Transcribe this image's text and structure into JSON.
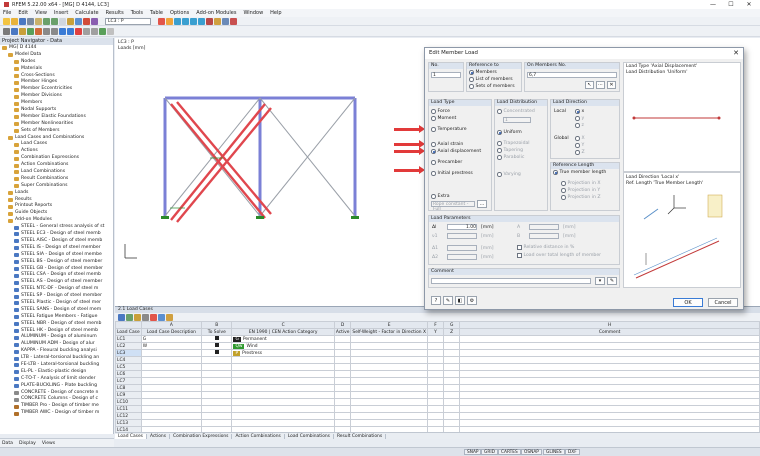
{
  "window": {
    "title": "RFEM 5.22.00 x64 - [MG] D 4144, LC3]",
    "min": "—",
    "max": "☐",
    "close": "✕"
  },
  "menu": [
    "File",
    "Edit",
    "View",
    "Insert",
    "Calculate",
    "Results",
    "Tools",
    "Table",
    "Options",
    "Add-on Modules",
    "Window",
    "Help"
  ],
  "toolbar": {
    "lc_select": "LC3 : P"
  },
  "navigator": {
    "title": "Project Navigator - Data",
    "items": [
      {
        "label": "MG] D 4144",
        "level": 0,
        "color": "#d8a33a"
      },
      {
        "label": "Model Data",
        "level": 1,
        "color": "#d8a33a"
      },
      {
        "label": "Nodes",
        "level": 2,
        "color": "#d8a33a"
      },
      {
        "label": "Materials",
        "level": 2,
        "color": "#d8a33a"
      },
      {
        "label": "Cross-Sections",
        "level": 2,
        "color": "#d8a33a"
      },
      {
        "label": "Member Hinges",
        "level": 2,
        "color": "#d8a33a"
      },
      {
        "label": "Member Eccentricities",
        "level": 2,
        "color": "#d8a33a"
      },
      {
        "label": "Member Divisions",
        "level": 2,
        "color": "#d8a33a"
      },
      {
        "label": "Members",
        "level": 2,
        "color": "#d8a33a"
      },
      {
        "label": "Nodal Supports",
        "level": 2,
        "color": "#d8a33a"
      },
      {
        "label": "Member Elastic Foundations",
        "level": 2,
        "color": "#d8a33a"
      },
      {
        "label": "Member Nonlinearities",
        "level": 2,
        "color": "#d8a33a"
      },
      {
        "label": "Sets of Members",
        "level": 2,
        "color": "#d8a33a"
      },
      {
        "label": "Load Cases and Combinations",
        "level": 1,
        "color": "#d8a33a"
      },
      {
        "label": "Load Cases",
        "level": 2,
        "color": "#d8a33a"
      },
      {
        "label": "Actions",
        "level": 2,
        "color": "#d8a33a"
      },
      {
        "label": "Combination Expressions",
        "level": 2,
        "color": "#d8a33a"
      },
      {
        "label": "Action Combinations",
        "level": 2,
        "color": "#d8a33a"
      },
      {
        "label": "Load Combinations",
        "level": 2,
        "color": "#d8a33a"
      },
      {
        "label": "Result Combinations",
        "level": 2,
        "color": "#d8a33a"
      },
      {
        "label": "Super Combinations",
        "level": 2,
        "color": "#d8a33a"
      },
      {
        "label": "Loads",
        "level": 1,
        "color": "#d8a33a"
      },
      {
        "label": "Results",
        "level": 1,
        "color": "#d8a33a"
      },
      {
        "label": "Printout Reports",
        "level": 1,
        "color": "#d8a33a"
      },
      {
        "label": "Guide Objects",
        "level": 1,
        "color": "#d8a33a"
      },
      {
        "label": "Add-on Modules",
        "level": 1,
        "color": "#d8a33a"
      },
      {
        "label": "STEEL - General stress analysis of st",
        "level": 2,
        "color": "#4a78c2"
      },
      {
        "label": "STEEL EC3 - Design of steel memb",
        "level": 2,
        "color": "#4a78c2"
      },
      {
        "label": "STEEL AISC - Design of steel memb",
        "level": 2,
        "color": "#4a78c2"
      },
      {
        "label": "STEEL IS - Design of steel member",
        "level": 2,
        "color": "#4a78c2"
      },
      {
        "label": "STEEL SIA - Design of steel membe",
        "level": 2,
        "color": "#4a78c2"
      },
      {
        "label": "STEEL BS - Design of steel member",
        "level": 2,
        "color": "#4a78c2"
      },
      {
        "label": "STEEL GB - Design of steel member",
        "level": 2,
        "color": "#4a78c2"
      },
      {
        "label": "STEEL CSA - Design of steel memb",
        "level": 2,
        "color": "#4a78c2"
      },
      {
        "label": "STEEL AS - Design of steel member",
        "level": 2,
        "color": "#4a78c2"
      },
      {
        "label": "STEEL NTC-DF - Design of steel m",
        "level": 2,
        "color": "#4a78c2"
      },
      {
        "label": "STEEL SP - Design of steel member",
        "level": 2,
        "color": "#4a78c2"
      },
      {
        "label": "STEEL Plastic - Design of steel mer",
        "level": 2,
        "color": "#4a78c2"
      },
      {
        "label": "STEEL SANS - Design of steel mem",
        "level": 2,
        "color": "#4a78c2"
      },
      {
        "label": "STEEL Fatigue Members - Fatigue",
        "level": 2,
        "color": "#4a78c2"
      },
      {
        "label": "STEEL NBR - Design of steel memb",
        "level": 2,
        "color": "#4a78c2"
      },
      {
        "label": "STEEL HK - Design of steel memb",
        "level": 2,
        "color": "#4a78c2"
      },
      {
        "label": "ALUMINUM - Design of aluminum",
        "level": 2,
        "color": "#4a78c2"
      },
      {
        "label": "ALUMINUM ADM - Design of alur",
        "level": 2,
        "color": "#4a78c2"
      },
      {
        "label": "KAPPA - Flexural buckling analysi",
        "level": 2,
        "color": "#4a78c2"
      },
      {
        "label": "LTB - Lateral-torsional buckling an",
        "level": 2,
        "color": "#4a78c2"
      },
      {
        "label": "FE-LTB - Lateral-torsional buckling",
        "level": 2,
        "color": "#4a78c2"
      },
      {
        "label": "EL-PL - Elastic-plastic design",
        "level": 2,
        "color": "#4a78c2"
      },
      {
        "label": "C-TO-T - Analysis of limit slender",
        "level": 2,
        "color": "#4a78c2"
      },
      {
        "label": "PLATE-BUCKLING - Plate buckling",
        "level": 2,
        "color": "#4a78c2"
      },
      {
        "label": "CONCRETE - Design of concrete n",
        "level": 2,
        "color": "#8a8a8a"
      },
      {
        "label": "CONCRETE Columns - Design of c",
        "level": 2,
        "color": "#8a8a8a"
      },
      {
        "label": "TIMBER Pro - Design of timber me",
        "level": 2,
        "color": "#b0702a"
      },
      {
        "label": "TIMBER AWC - Design of timber m",
        "level": 2,
        "color": "#b0702a"
      }
    ],
    "bottom_tabs": [
      "Data",
      "Display",
      "Views"
    ]
  },
  "workspace": {
    "lc": "LC3 : P",
    "units": "Loads [mm]"
  },
  "dialog": {
    "title": "Edit Member Load",
    "no_label": "No.",
    "no_value": "1",
    "ref_label": "Reference to",
    "ref_opts": [
      "Members",
      "List of members",
      "Sets of members"
    ],
    "onmembers_label": "On Members No.",
    "onmembers_value": "6,7",
    "load_type_label": "Load Type",
    "load_types": [
      "Force",
      "Moment",
      "Temperature",
      "Axial strain",
      "Axial displacement",
      "Precamber",
      "Initial prestress"
    ],
    "load_types_extra": "Extra",
    "extra_value": "Rope constant - Full",
    "load_dist_label": "Load Distribution",
    "load_dists": [
      "Concentrated",
      "Uniform",
      "Trapezoidal",
      "Tapering",
      "Parabolic",
      "Varying"
    ],
    "dist_field": "1",
    "load_dir_label": "Load Direction",
    "local_label": "Local",
    "global_label": "Global",
    "dir_local": [
      "x",
      "y",
      "z"
    ],
    "dir_global": [
      "X",
      "Y",
      "Z"
    ],
    "ref_length_label": "Reference Length",
    "ref_lengths": [
      "True member length",
      "Projection in X",
      "Projection in Y",
      "Projection in Z"
    ],
    "load_params_label": "Load Parameters",
    "params": [
      {
        "sym": "Δl",
        "value": "1.00",
        "unit": "[mm]"
      },
      {
        "sym": "ν1",
        "value": "",
        "unit": "[mm]"
      },
      {
        "sym": "Δ1",
        "value": "",
        "unit": "[mm]"
      },
      {
        "sym": "Δ2",
        "value": "",
        "unit": "[mm]"
      }
    ],
    "params_right": [
      {
        "sym": "A",
        "value": "",
        "unit": "[mm]"
      },
      {
        "sym": "B",
        "value": "",
        "unit": "[mm]"
      }
    ],
    "relative_label": "Relative distance in %",
    "load_over_label": "Load over total length of member",
    "comment_label": "Comment",
    "ok": "OK",
    "cancel": "Cancel",
    "preview_top": "Load Type 'Axial Displacement'",
    "preview_top2": "Load Distribution 'Uniform'",
    "preview_mid": "Load Direction 'Local x'",
    "preview_mid2": "Ref. Length 'True Member Length'"
  },
  "table": {
    "title": "2.1 Load Cases",
    "col_letters": [
      "A",
      "B",
      "",
      "C",
      "D",
      "E",
      "F",
      "G",
      "H"
    ],
    "headers": [
      "Load Case",
      "Load Case Description",
      "To Solve",
      "EN 1990 | CEN Action Category",
      "Active",
      "Self-Weight - Factor in Direction X",
      "Y",
      "Z",
      "Comment"
    ],
    "rows": [
      {
        "id": "LC1",
        "desc": "G",
        "solve": true,
        "cat": "Permanent",
        "badge": "G",
        "badge_color": "#222"
      },
      {
        "id": "LC2",
        "desc": "W",
        "solve": true,
        "cat": "Wind",
        "badge": "Qw",
        "badge_color": "#2f9a2f"
      },
      {
        "id": "LC3",
        "desc": "",
        "solve": true,
        "cat": "Prestress",
        "badge": "P",
        "badge_color": "#c2a12a"
      },
      {
        "id": "LC4"
      },
      {
        "id": "LC5"
      },
      {
        "id": "LC6"
      },
      {
        "id": "LC7"
      },
      {
        "id": "LC8"
      },
      {
        "id": "LC9"
      },
      {
        "id": "LC10"
      },
      {
        "id": "LC11"
      },
      {
        "id": "LC12"
      },
      {
        "id": "LC13"
      },
      {
        "id": "LC14"
      }
    ]
  },
  "sheet_tabs": [
    "Load Cases",
    "Actions",
    "Combination Expressions",
    "Action Combinations",
    "Load Combinations",
    "Result Combinations"
  ],
  "status": [
    "SNAP",
    "GRID",
    "CARTES",
    "OSNAP",
    "GLINES",
    "DXF"
  ]
}
